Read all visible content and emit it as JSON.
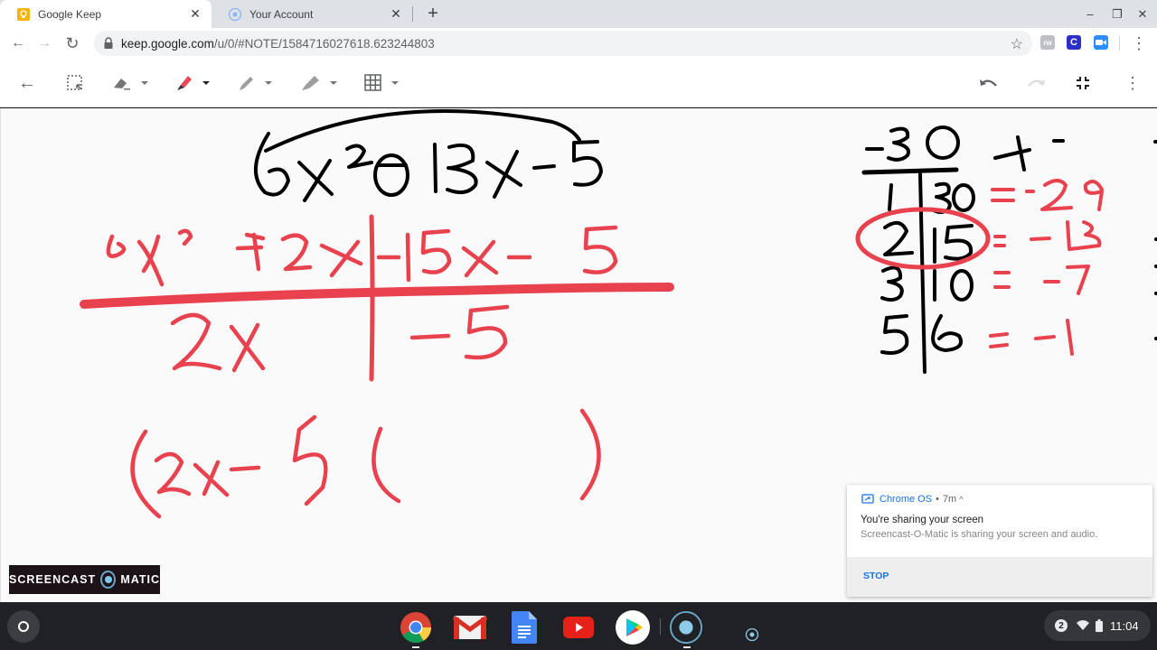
{
  "browser": {
    "tabs": [
      {
        "title": "Google Keep",
        "icon": "keep-icon",
        "active": true
      },
      {
        "title": "Your Account",
        "icon": "account-icon",
        "active": false
      }
    ],
    "new_tab_label": "+",
    "close_glyph": "✕",
    "window_controls": {
      "minimize": "–",
      "restore": "❐",
      "close": "✕"
    },
    "nav": {
      "back": "←",
      "forward": "→",
      "reload": "↻"
    },
    "url_host": "keep.google.com",
    "url_rest": "/u/0/#NOTE/1584716027618.623244803",
    "star": "☆",
    "extensions": [
      {
        "name": "rw-extension-icon",
        "label": "rw",
        "color": "#9aa0a6"
      },
      {
        "name": "c-extension-icon",
        "label": "C",
        "color": "#2d2dc8"
      },
      {
        "name": "zoom-extension-icon",
        "label": "▪",
        "color": "#2d8cff"
      }
    ],
    "menu": "⋮"
  },
  "keep_toolbar": {
    "back": "←",
    "tools": [
      {
        "name": "select-tool",
        "icon": "lasso-select-icon",
        "dropdown": false
      },
      {
        "name": "eraser-tool",
        "icon": "eraser-icon",
        "dropdown": true
      },
      {
        "name": "pen-tool",
        "icon": "pen-icon",
        "dropdown": true,
        "active": true,
        "color": "#e84855"
      },
      {
        "name": "marker-tool",
        "icon": "marker-icon",
        "dropdown": true
      },
      {
        "name": "highlighter-tool",
        "icon": "highlighter-icon",
        "dropdown": true
      },
      {
        "name": "background-grid-tool",
        "icon": "grid-icon",
        "dropdown": true
      }
    ],
    "right": {
      "undo": "undo-icon",
      "redo": "redo-icon",
      "exit_fullscreen": "exit-fullscreen-icon",
      "more": "⋮"
    }
  },
  "drawing": {
    "ink_colors": {
      "black": "#000000",
      "red": "#e8424f"
    },
    "handwritten_content": {
      "problem": "6x² − 13x − 5",
      "grouping_top": "6x² + 2x | −15x − 5",
      "grouping_bottom": "2x | −5",
      "factored_partial": "(2x − 5)(      )",
      "factor_table_header": "−30",
      "factor_table_note": "+ −",
      "factor_pairs": [
        {
          "pair": "1 | 30",
          "sum": "= −29",
          "circled": false
        },
        {
          "pair": "2 | 15",
          "sum": "= −13",
          "circled": true
        },
        {
          "pair": "3 | 10",
          "sum": "= −7",
          "circled": false
        },
        {
          "pair": "5 | 6",
          "sum": "= −1",
          "circled": false
        }
      ]
    }
  },
  "watermark": {
    "left": "SCREENCAST",
    "right": "MATIC"
  },
  "notification": {
    "source": "Chrome OS",
    "separator": "•",
    "time": "7m",
    "expand": "^",
    "title": "You're sharing your screen",
    "message": "Screencast-O-Matic is sharing your screen and audio.",
    "action": "STOP"
  },
  "shelf": {
    "apps": [
      {
        "name": "chrome-app",
        "running": true
      },
      {
        "name": "gmail-app",
        "running": false
      },
      {
        "name": "docs-app",
        "running": false
      },
      {
        "name": "youtube-app",
        "running": false
      },
      {
        "name": "play-store-app",
        "running": false
      },
      {
        "name": "screencast-o-matic-app",
        "running": true
      }
    ],
    "status": {
      "notification_count": "2",
      "time": "11:04"
    }
  }
}
